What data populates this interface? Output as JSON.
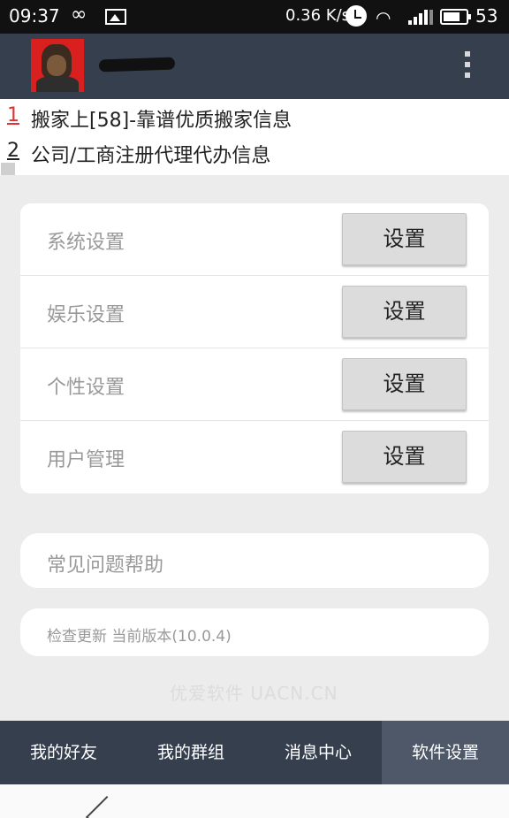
{
  "status_bar": {
    "time": "09:37",
    "infinity_icon": "∞",
    "speed": "0.36 K/s",
    "wifi_icon": "wifi-icon",
    "battery_level": "53"
  },
  "ads": [
    {
      "num": "1",
      "text": "搬家上[58]-靠谱优质搬家信息"
    },
    {
      "num": "2",
      "text": "公司/工商注册代理代办信息"
    }
  ],
  "settings": [
    {
      "label": "系统设置",
      "button": "设置"
    },
    {
      "label": "娱乐设置",
      "button": "设置"
    },
    {
      "label": "个性设置",
      "button": "设置"
    },
    {
      "label": "用户管理",
      "button": "设置"
    }
  ],
  "help": {
    "label": "常见问题帮助"
  },
  "update": {
    "label": "检查更新 当前版本(10.0.4)"
  },
  "watermark": "优爱软件   UACN.CN",
  "tabs": [
    {
      "label": "我的好友"
    },
    {
      "label": "我的群组"
    },
    {
      "label": "消息中心"
    },
    {
      "label": "软件设置"
    }
  ]
}
